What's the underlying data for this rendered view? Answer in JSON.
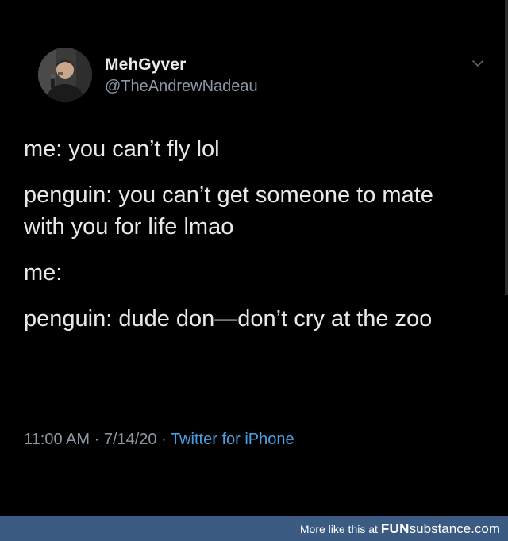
{
  "tweet": {
    "display_name": "MehGyver",
    "handle": "@TheAndrewNadeau",
    "lines": [
      "me: you can’t fly lol",
      "penguin: you can’t get someone to mate with you for life lmao",
      "me:",
      "penguin: dude don—don’t cry at the zoo"
    ],
    "time": "11:00 AM",
    "date": "7/14/20",
    "separator": "·",
    "source": "Twitter for iPhone"
  },
  "icons": {
    "menu": "chevron-down-icon",
    "avatar": "profile-avatar"
  },
  "footer": {
    "prefix": "More like this at ",
    "brand_fun": "FUN",
    "brand_sub": "substance",
    "brand_tld": ".com"
  },
  "colors": {
    "background": "#000000",
    "name_text": "#e9eaeb",
    "body_text": "#e7e9ea",
    "meta_text": "#8b98a5",
    "link_blue": "#4a9fe0",
    "footer_bar": "#3b5b83"
  }
}
